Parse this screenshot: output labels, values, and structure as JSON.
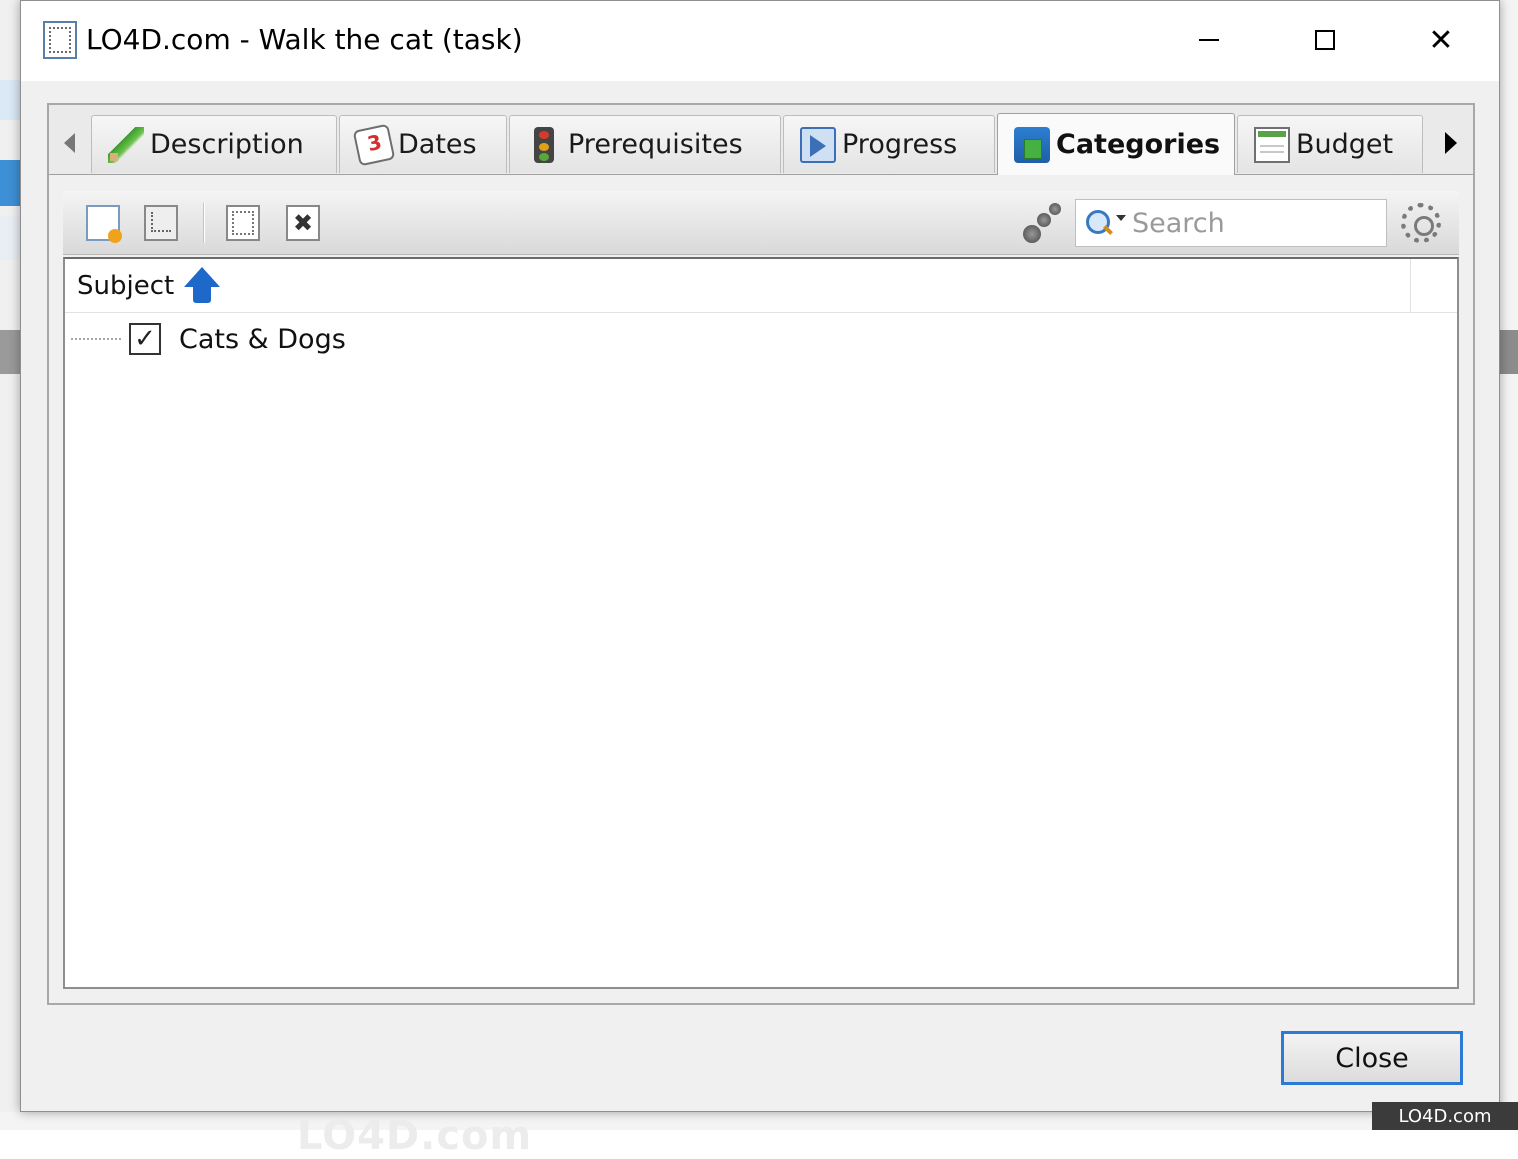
{
  "window": {
    "title": "LO4D.com - Walk the cat (task)"
  },
  "tabs": [
    {
      "label": "Description",
      "icon": "pencil-icon"
    },
    {
      "label": "Dates",
      "icon": "calendar-icon"
    },
    {
      "label": "Prerequisites",
      "icon": "traffic-light-icon"
    },
    {
      "label": "Progress",
      "icon": "progress-arrow-icon"
    },
    {
      "label": "Categories",
      "icon": "categories-icon",
      "active": true
    },
    {
      "label": "Budget",
      "icon": "spreadsheet-icon"
    }
  ],
  "toolbar": {
    "search_placeholder": "Search"
  },
  "tree": {
    "column_header": "Subject",
    "rows": [
      {
        "label": "Cats & Dogs",
        "checked": true
      }
    ]
  },
  "watermark": "LO4D.com",
  "buttons": {
    "close_label": "Close"
  },
  "colors": {
    "accent": "#2a7ad6",
    "sort_arrow": "#1e68c9"
  }
}
